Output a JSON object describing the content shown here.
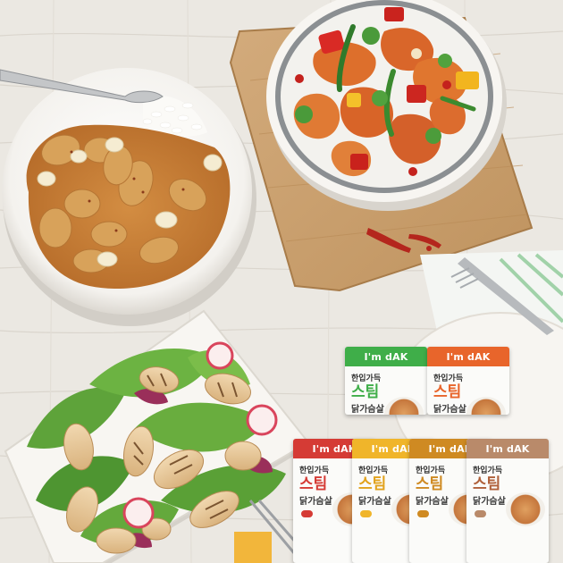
{
  "image": {
    "description_colors": {
      "table": "#ece9e3",
      "board": "#c89d6b",
      "curry": "#c4813a",
      "sauce_chicken": "#d8692a",
      "lettuce": "#5fa43a"
    }
  },
  "packs": [
    {
      "brand": "I'm dAK",
      "line1": "한입가득",
      "line2": "스팀",
      "line3": "닭가슴살",
      "flavor": "",
      "color": "#3fae49"
    },
    {
      "brand": "I'm dAK",
      "line1": "한입가득",
      "line2": "스팀",
      "line3": "닭가슴살",
      "flavor": "",
      "color": "#e8652b"
    },
    {
      "brand": "I'm dAK",
      "line1": "한입가득",
      "line2": "스팀",
      "line3": "닭가슴살",
      "flavor": "",
      "color": "#d53b35"
    },
    {
      "brand": "I'm dAK",
      "line1": "한입가득",
      "line2": "스팀",
      "line3": "닭가슴살",
      "flavor": "",
      "color": "#f0b52a"
    },
    {
      "brand": "I'm dAK",
      "line1": "한입가득",
      "line2": "스팀",
      "line3": "닭가슴살",
      "flavor": "",
      "color": "#cf8a22"
    },
    {
      "brand": "I'm dAK",
      "line1": "한입가득",
      "line2": "스팀",
      "line3": "닭가슴살",
      "flavor": "",
      "color": "#b98a6a"
    }
  ]
}
